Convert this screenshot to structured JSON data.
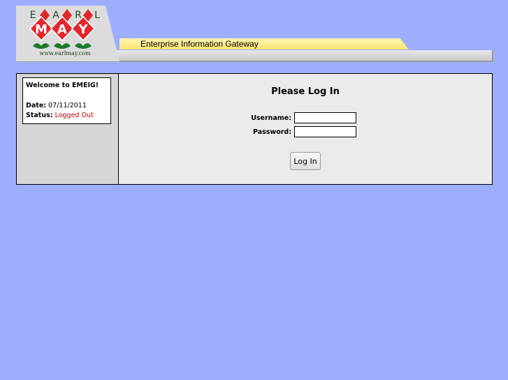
{
  "header": {
    "logo_letters": [
      "E",
      "A",
      "R",
      "L"
    ],
    "logo_word": [
      "M",
      "A",
      "Y"
    ],
    "logo_url": "www.earlmay.com",
    "gateway_title": "Enterprise Information Gateway",
    "colors": {
      "diamond_red": "#e2262d",
      "leaf_green": "#1e7a2e",
      "tab_yellow": "#f6e46f"
    }
  },
  "sidebar": {
    "welcome": "Welcome to EMEIG!",
    "date_label": "Date:",
    "date_value": "07/11/2011",
    "status_label": "Status:",
    "status_value": "Logged Out"
  },
  "login": {
    "title": "Please Log In",
    "username_label": "Username:",
    "username_value": "",
    "password_label": "Password:",
    "password_value": "",
    "button_label": "Log In"
  }
}
